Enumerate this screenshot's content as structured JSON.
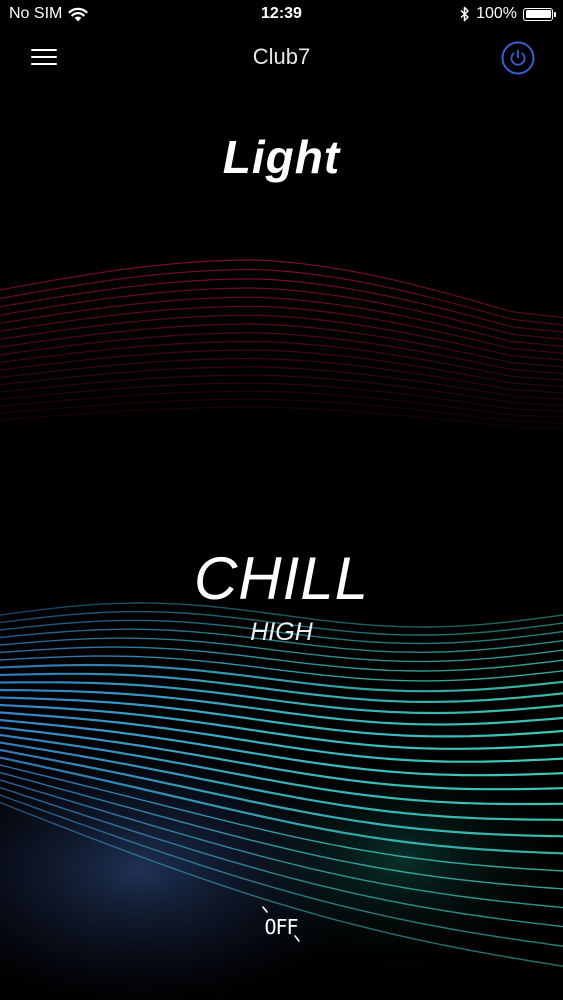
{
  "status_bar": {
    "carrier": "No SIM",
    "time": "12:39",
    "battery": "100%",
    "battery_level": 1.0
  },
  "nav": {
    "title": "Club7",
    "menu_icon": "hamburger-menu-icon",
    "power_icon": "power-icon"
  },
  "mode": {
    "title": "Light"
  },
  "scene": {
    "name": "CHILL",
    "level": "HIGH"
  },
  "off_button": {
    "label": "OFF"
  },
  "colors": {
    "background": "#000000",
    "accent_power": "#3a5ed8",
    "wave_top": "#c0143c",
    "wave_bottom": "#3fd9d0",
    "wave_bottom_alt": "#3b8ee0",
    "glow": "#3a5aa0"
  }
}
